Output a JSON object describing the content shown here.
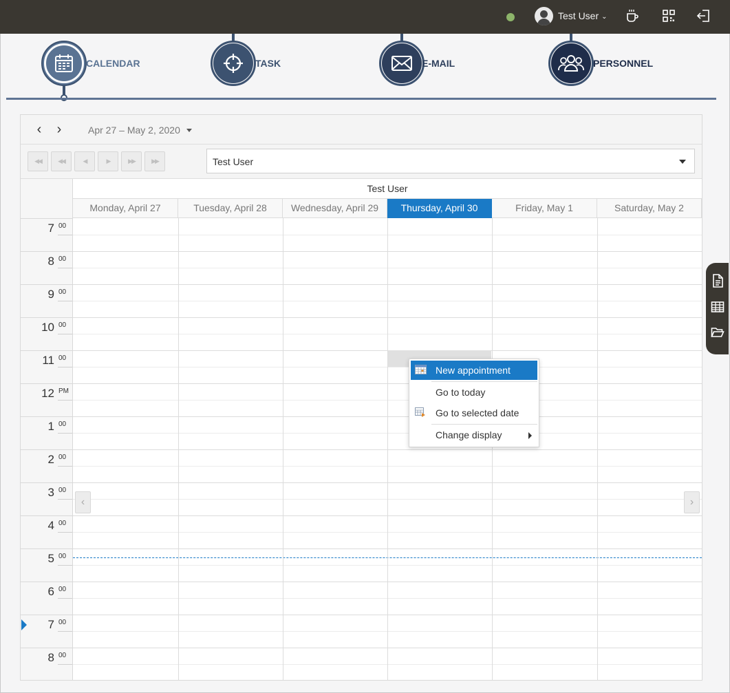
{
  "topbar": {
    "user_name": "Test User",
    "colors": {
      "bar": "#3a3731",
      "status_online": "#8db46a"
    },
    "icons": [
      "status-dot",
      "user-avatar-icon",
      "chevron-down-icon",
      "coffee-cup-icon",
      "qr-code-icon",
      "logout-icon"
    ]
  },
  "modules": [
    {
      "label": "CALENDAR",
      "icon": "calendar-icon",
      "active": true
    },
    {
      "label": "TASK",
      "icon": "crosshair-icon",
      "active": false
    },
    {
      "label": "E-MAIL",
      "icon": "envelope-icon",
      "active": false
    },
    {
      "label": "PERSONNEL",
      "icon": "people-group-icon",
      "active": false
    }
  ],
  "scheduler": {
    "range_label": "Apr 27 – May 2, 2020",
    "resource_select_value": "Test User",
    "resource_header": "Test User",
    "pager_buttons": [
      "first-page",
      "previous-group",
      "previous",
      "next",
      "next-group",
      "last-page"
    ],
    "days": [
      {
        "label": "Monday, April 27",
        "today": false
      },
      {
        "label": "Tuesday, April 28",
        "today": false
      },
      {
        "label": "Wednesday, April 29",
        "today": false
      },
      {
        "label": "Thursday, April 30",
        "today": true
      },
      {
        "label": "Friday, May 1",
        "today": false
      },
      {
        "label": "Saturday, May 2",
        "today": false
      }
    ],
    "hours": [
      {
        "hour": "7",
        "suffix": "00"
      },
      {
        "hour": "8",
        "suffix": "00"
      },
      {
        "hour": "9",
        "suffix": "00"
      },
      {
        "hour": "10",
        "suffix": "00"
      },
      {
        "hour": "11",
        "suffix": "00"
      },
      {
        "hour": "12",
        "suffix": "PM"
      },
      {
        "hour": "1",
        "suffix": "00"
      },
      {
        "hour": "2",
        "suffix": "00"
      },
      {
        "hour": "3",
        "suffix": "00"
      },
      {
        "hour": "4",
        "suffix": "00"
      },
      {
        "hour": "5",
        "suffix": "00"
      },
      {
        "hour": "6",
        "suffix": "00"
      },
      {
        "hour": "7",
        "suffix": "00"
      },
      {
        "hour": "8",
        "suffix": "00"
      }
    ],
    "selected_slot": {
      "day": "Thursday, April 30",
      "time": "11:00"
    },
    "colors": {
      "today": "#1a7ac6",
      "accent": "#3c5270"
    }
  },
  "context_menu": {
    "items": [
      {
        "label": "New appointment",
        "icon": "calendar-grid-icon",
        "active": true
      },
      {
        "label": "Go to today",
        "icon": "",
        "active": false
      },
      {
        "label": "Go to selected date",
        "icon": "calendar-goto-icon",
        "active": false
      },
      {
        "label": "Change display",
        "icon": "",
        "active": false,
        "submenu": true
      }
    ]
  },
  "side_dock": {
    "icons": [
      "document-icon",
      "table-grid-icon",
      "folder-open-icon"
    ]
  }
}
